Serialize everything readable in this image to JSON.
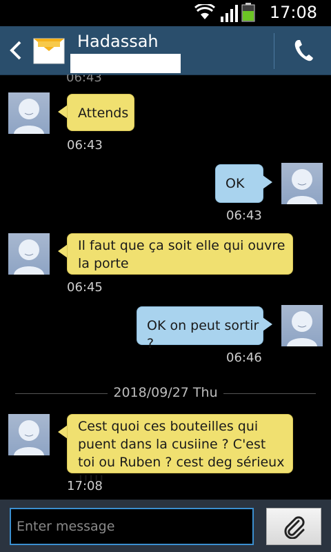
{
  "status_bar": {
    "time": "17:08"
  },
  "header": {
    "contact_name": "Hadassah"
  },
  "conversation": {
    "messages": [
      {
        "direction": "incoming",
        "text": "Attends",
        "time": "06:43"
      },
      {
        "direction": "outgoing",
        "text": "OK",
        "time": "06:43"
      },
      {
        "direction": "incoming",
        "text": "Il faut que ça soit elle qui ouvre la porte",
        "time": "06:45"
      },
      {
        "direction": "outgoing",
        "text": "OK on peut sortir ?",
        "time": "06:46"
      },
      {
        "direction": "incoming",
        "text": "Cest quoi ces bouteilles qui puent dans la cusiine ? C'est toi ou Ruben ? cest deg sérieux !!!!!",
        "time": "17:08"
      }
    ],
    "partial_top_time": "06:43",
    "date_separator": "2018/09/27 Thu"
  },
  "composer": {
    "placeholder": "Enter message",
    "value": ""
  },
  "colors": {
    "header": "#2a4e6c",
    "incoming_bubble": "#f0e070",
    "outgoing_bubble": "#a9d3ee",
    "input_border": "#3b8fd0"
  },
  "icons": [
    "wifi-icon",
    "signal-icon",
    "battery-icon",
    "back-icon",
    "envelope-icon",
    "phone-icon",
    "attach-icon",
    "avatar-icon"
  ]
}
